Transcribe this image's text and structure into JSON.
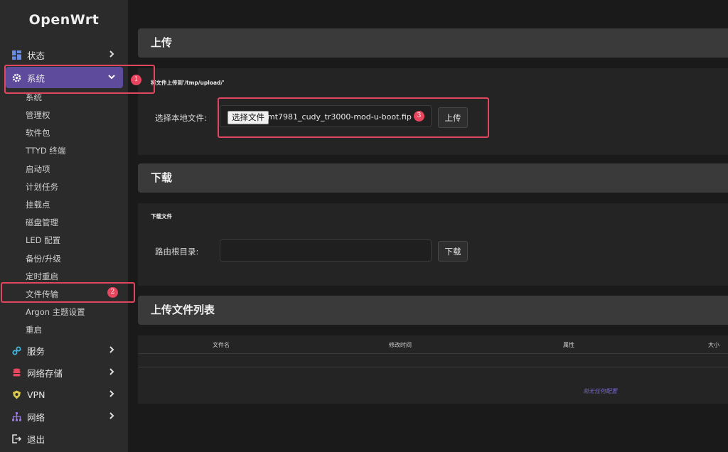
{
  "brand": "OpenWrt",
  "sidebar": {
    "top_items": [
      {
        "label": "状态"
      },
      {
        "label": "系统"
      }
    ],
    "sub_items": [
      "系统",
      "管理权",
      "软件包",
      "TTYD 终端",
      "启动项",
      "计划任务",
      "挂载点",
      "磁盘管理",
      "LED 配置",
      "备份/升级",
      "定时重启",
      "文件传输",
      "Argon 主题设置",
      "重启"
    ],
    "bottom_items": [
      {
        "label": "服务"
      },
      {
        "label": "网络存储"
      },
      {
        "label": "VPN"
      },
      {
        "label": "网络"
      },
      {
        "label": "退出"
      }
    ]
  },
  "upload": {
    "heading": "上传",
    "section_title": "将文件上传到'/tmp/upload/'",
    "label": "选择本地文件:",
    "choose_button": "选择文件",
    "filename": "mt7981_cudy_tr3000-mod-u-boot.fip",
    "submit": "上传"
  },
  "download": {
    "heading": "下载",
    "section_title": "下载文件",
    "label": "路由根目录:",
    "input_value": "",
    "submit": "下载"
  },
  "filelist": {
    "heading": "上传文件列表",
    "columns": [
      "文件名",
      "修改时间",
      "属性",
      "大小"
    ],
    "empty": "尚无任何配置"
  },
  "annotations": [
    "1",
    "2",
    "3"
  ],
  "colors": {
    "accent": "#5e4b9c",
    "highlight": "#e0465e"
  }
}
